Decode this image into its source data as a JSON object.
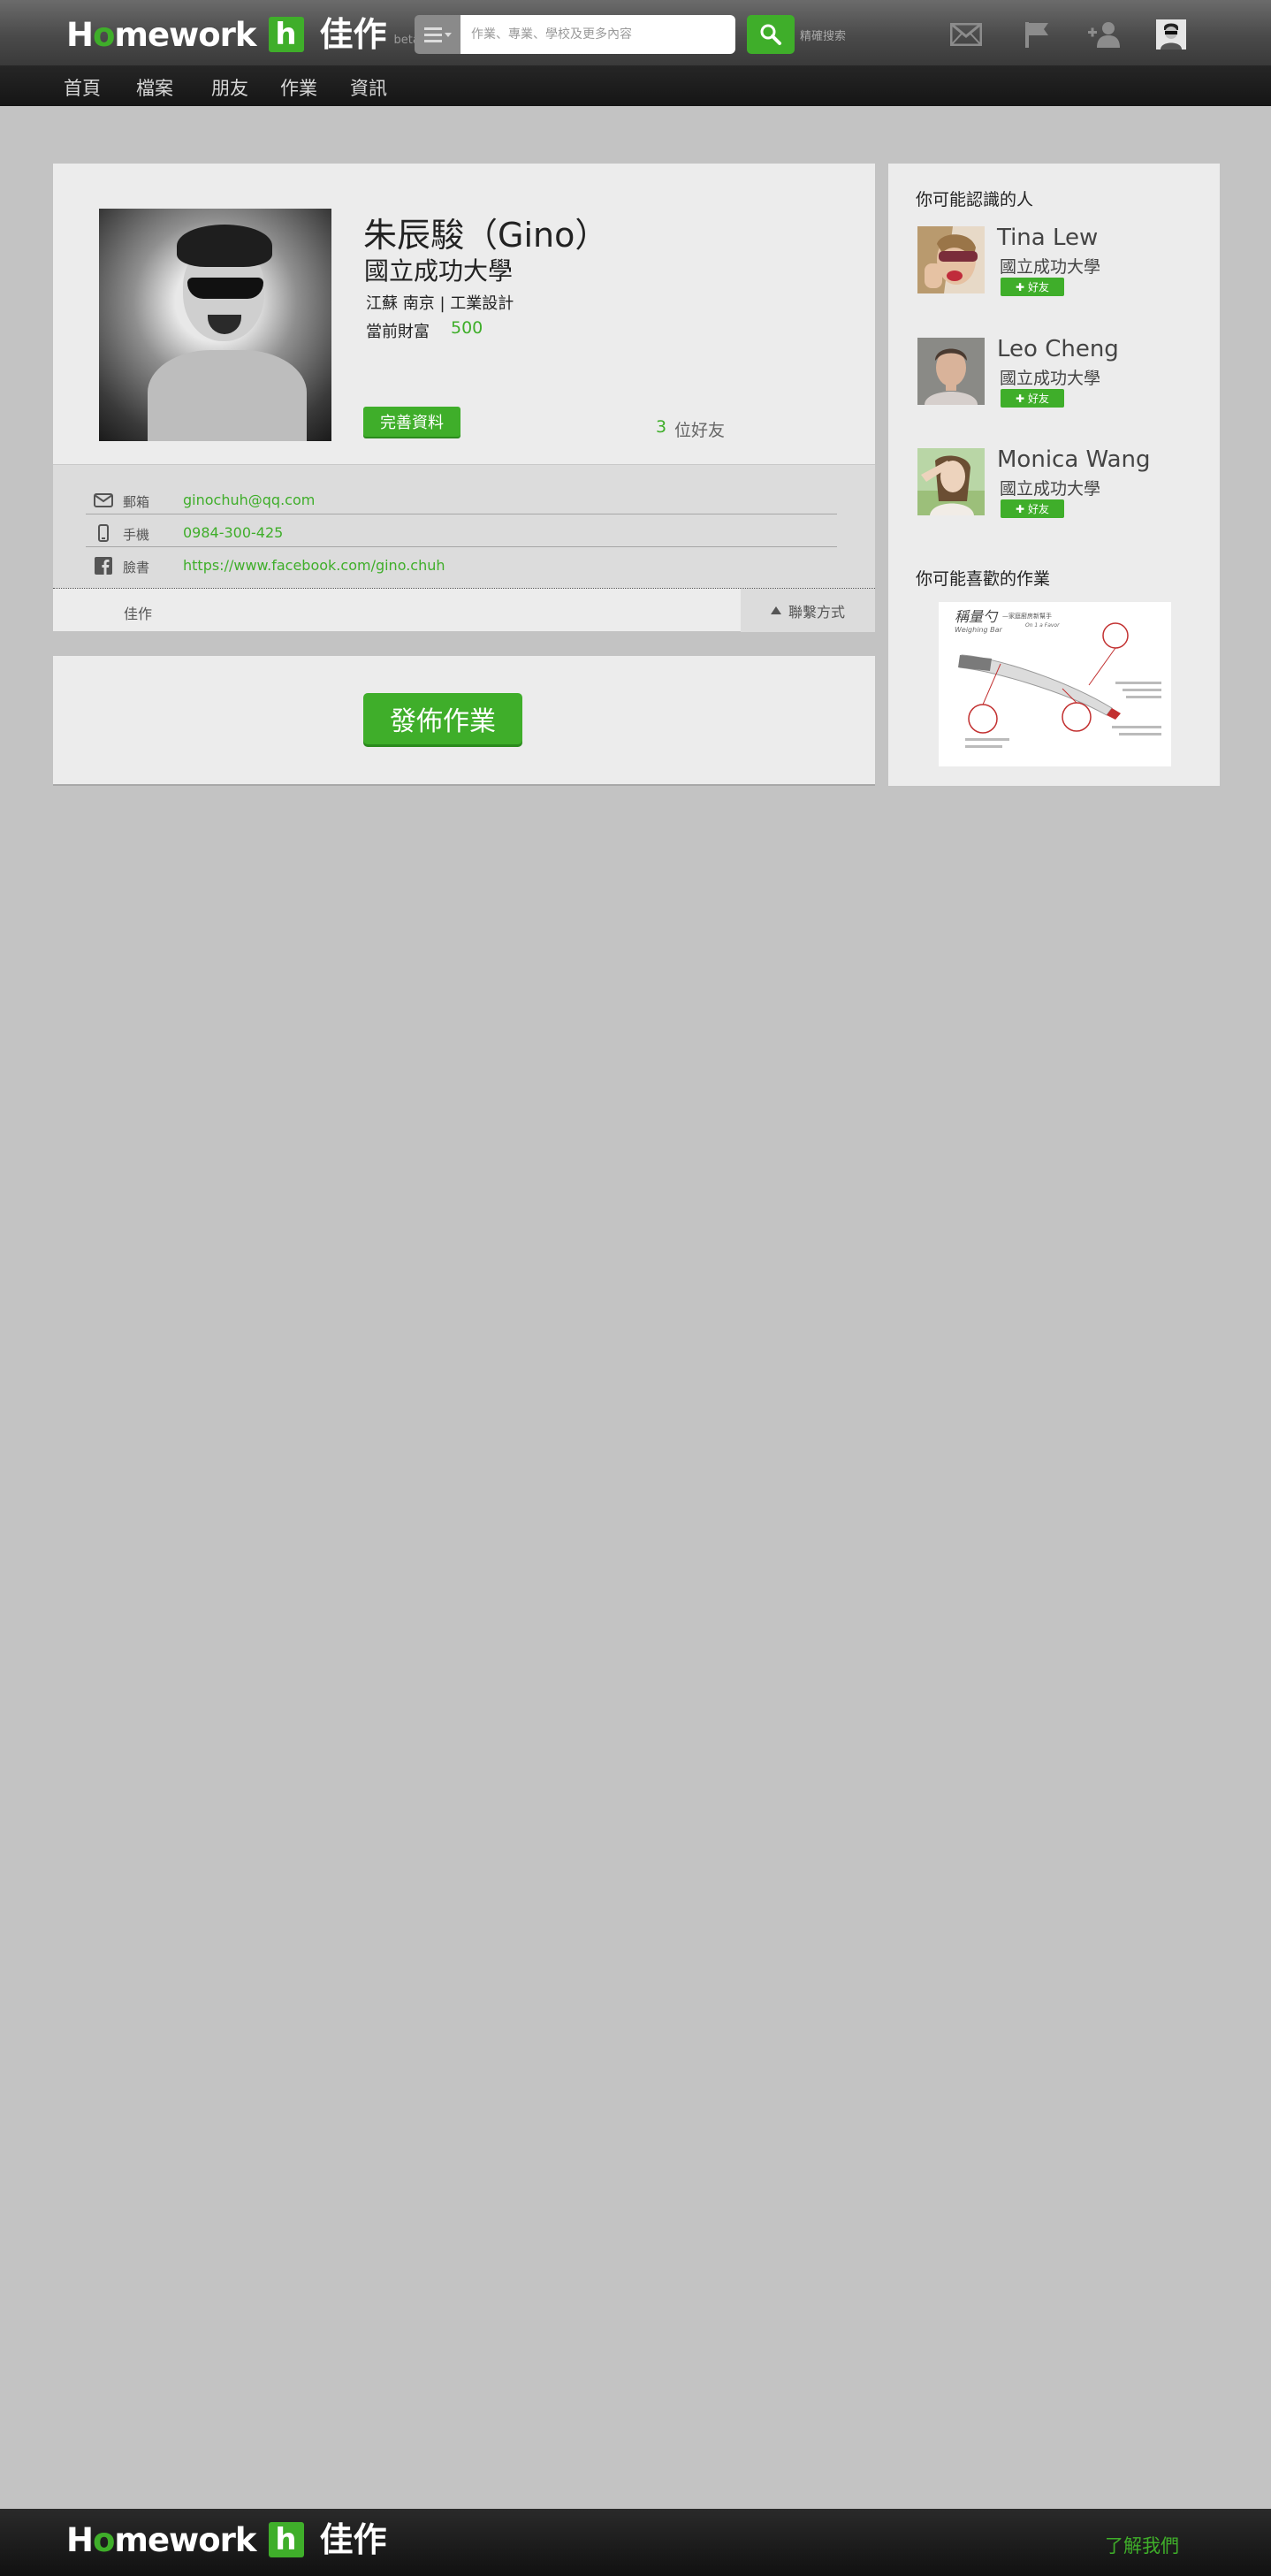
{
  "header": {
    "logo_word_h": "H",
    "logo_word_o": "o",
    "logo_word_rest": "mework",
    "logo_badge": "h",
    "logo_cn": "佳作",
    "logo_beta": "beta",
    "search_placeholder": "作業、專業、學校及更多內容",
    "advanced_search": "精確搜索",
    "icons": [
      "menu-icon",
      "search-icon",
      "mail-icon",
      "flag-icon",
      "add-friend-icon",
      "user-avatar-icon"
    ]
  },
  "nav": {
    "items": [
      "首頁",
      "檔案",
      "朋友",
      "作業",
      "資訊"
    ]
  },
  "profile": {
    "name": "朱辰駿（Gino）",
    "school": "國立成功大學",
    "location": "江蘇  南京 | 工業設計",
    "wealth_label": "當前財富",
    "wealth_value": "500",
    "complete_button": "完善資料",
    "friends_count": "3",
    "friends_label": "位好友",
    "contacts": [
      {
        "icon": "mail-icon",
        "label": "郵箱",
        "value": "ginochuh@qq.com"
      },
      {
        "icon": "phone-icon",
        "label": "手機",
        "value": "0984-300-425"
      },
      {
        "icon": "facebook-icon",
        "label": "臉書",
        "value": "https://www.facebook.com/gino.chuh"
      }
    ],
    "tab_works": "佳作",
    "tab_contact": "聯繫方式"
  },
  "publish": {
    "button": "發佈作業"
  },
  "sidebar": {
    "people_title": "你可能認識的人",
    "people": [
      {
        "name": "Tina Lew",
        "school": "國立成功大學",
        "add_label": "好友"
      },
      {
        "name": "Leo Cheng",
        "school": "國立成功大學",
        "add_label": "好友"
      },
      {
        "name": "Monica Wang",
        "school": "國立成功大學",
        "add_label": "好友"
      }
    ],
    "works_title": "你可能喜歡的作業",
    "work": {
      "title": "稱量勺",
      "subtitle_cn": "—家庭廚房新幫手",
      "subtitle_en": "Weighing Bar",
      "tagline": "On 1 a Favor"
    }
  },
  "footer": {
    "about": "了解我們"
  },
  "colors": {
    "accent": "#3fae2a",
    "page_bg": "#c3c3c3",
    "card_bg": "#ececec"
  }
}
